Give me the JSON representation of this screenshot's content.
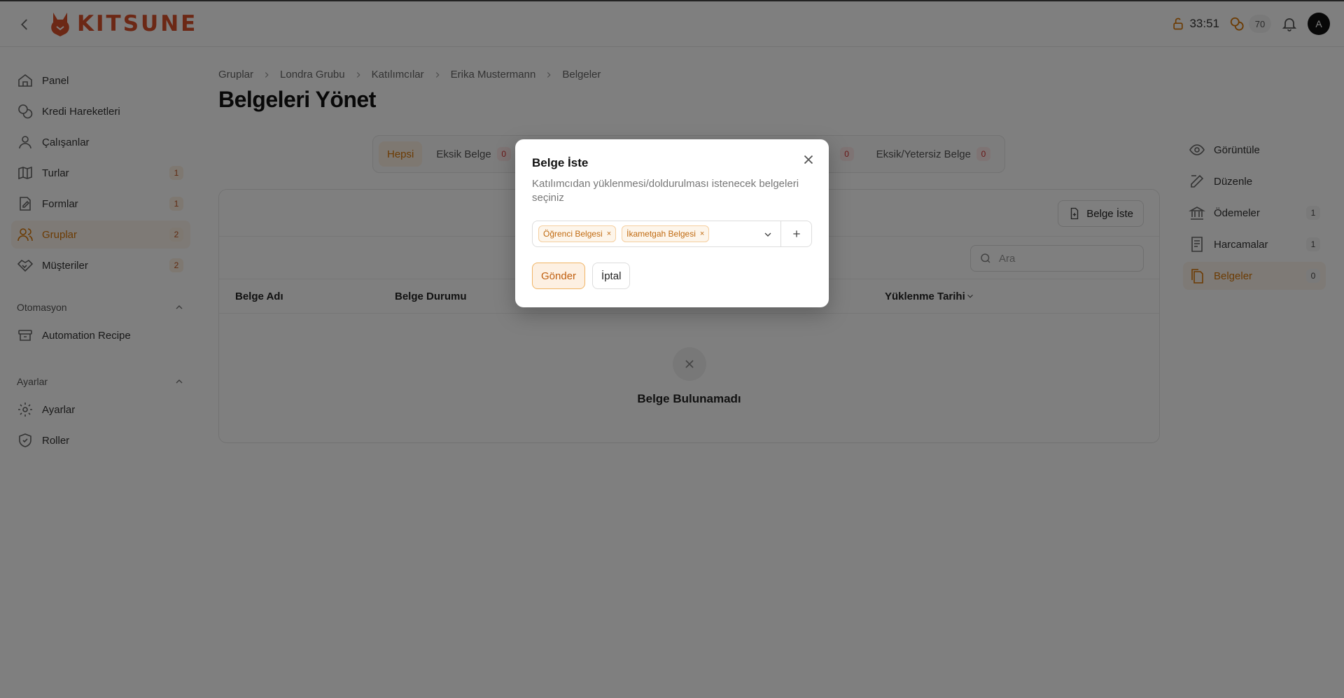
{
  "brand": {
    "name": "KITSUNE",
    "accent": "#d9502b"
  },
  "topbar": {
    "timer": "33:51",
    "credits": "70",
    "avatar_initial": "A"
  },
  "sidebar": {
    "items": [
      {
        "label": "Panel",
        "icon": "home-icon",
        "badge": ""
      },
      {
        "label": "Kredi Hareketleri",
        "icon": "coins-icon",
        "badge": ""
      },
      {
        "label": "Çalışanlar",
        "icon": "user-icon",
        "badge": ""
      },
      {
        "label": "Turlar",
        "icon": "map-icon",
        "badge": "1"
      },
      {
        "label": "Formlar",
        "icon": "form-icon",
        "badge": "1"
      },
      {
        "label": "Gruplar",
        "icon": "users-icon",
        "badge": "2",
        "active": true
      },
      {
        "label": "Müşteriler",
        "icon": "handshake-icon",
        "badge": "2"
      }
    ],
    "automation_section": "Otomasyon",
    "automation_items": [
      {
        "label": "Automation Recipe",
        "icon": "archive-icon"
      }
    ],
    "settings_section": "Ayarlar",
    "settings_items": [
      {
        "label": "Ayarlar",
        "icon": "gear-icon"
      },
      {
        "label": "Roller",
        "icon": "shield-icon"
      }
    ]
  },
  "breadcrumb": [
    "Gruplar",
    "Londra Grubu",
    "Katılımcılar",
    "Erika Mustermann",
    "Belgeler"
  ],
  "page": {
    "title": "Belgeleri Yönet"
  },
  "tabs": [
    {
      "label": "Hepsi",
      "active": true,
      "badge": ""
    },
    {
      "label": "Eksik Belge",
      "badge": "0"
    },
    {
      "label": "",
      "badge": "0"
    },
    {
      "label": "Eksik/Yetersiz Belge",
      "badge": "0"
    }
  ],
  "card": {
    "request_button": "Belge İste",
    "search_placeholder": "Ara",
    "columns": {
      "name": "Belge Adı",
      "status": "Belge Durumu",
      "uploaded": "Yüklenme Tarihi"
    },
    "empty_text": "Belge Bulunamadı"
  },
  "rightnav": {
    "items": [
      {
        "label": "Görüntüle",
        "badge": ""
      },
      {
        "label": "Düzenle",
        "badge": ""
      },
      {
        "label": "Ödemeler",
        "badge": "1"
      },
      {
        "label": "Harcamalar",
        "badge": "1"
      },
      {
        "label": "Belgeler",
        "badge": "0",
        "active": true
      }
    ]
  },
  "modal": {
    "title": "Belge İste",
    "description": "Katılımcıdan yüklenmesi/doldurulması istenecek belgeleri seçiniz",
    "chips": [
      "Öğrenci Belgesi",
      "İkametgah Belgesi"
    ],
    "chip_remove": "×",
    "send_label": "Gönder",
    "cancel_label": "İptal"
  }
}
